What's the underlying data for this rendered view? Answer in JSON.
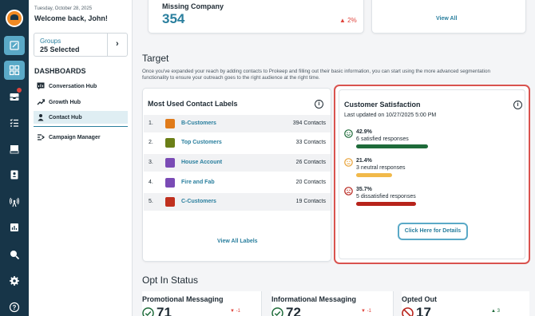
{
  "sidebar": {
    "date": "Tuesday, October 28, 2025",
    "welcome": "Welcome back, John!",
    "groups_label": "Groups",
    "groups_value": "25 Selected",
    "dashboards_heading": "DASHBOARDS",
    "items": [
      {
        "label": "Conversation Hub",
        "icon": "chat-stats-icon"
      },
      {
        "label": "Growth Hub",
        "icon": "growth-chart-icon"
      },
      {
        "label": "Contact Hub",
        "icon": "contact-person-icon",
        "active": true
      },
      {
        "label": "Campaign Manager",
        "icon": "campaign-icon"
      }
    ]
  },
  "rail": {
    "icons": [
      "logo-icon",
      "compose-icon",
      "dashboard-icon",
      "inbox-icon",
      "tasks-icon",
      "folder-icon",
      "contacts-icon",
      "broadcast-icon",
      "reports-icon",
      "search-icon",
      "settings-icon",
      "help-icon"
    ]
  },
  "top_cards": {
    "missing_company": {
      "title": "Missing Company",
      "value": "354",
      "change": "2%"
    },
    "view_all": "View All"
  },
  "target": {
    "title": "Target",
    "description": "Once you've expanded your reach by adding contacts to Prokeep and filling out their basic information, you can start using the more advanced segmentation functionality to ensure your outreach goes to the right audience at the right time."
  },
  "labels_card": {
    "title": "Most Used Contact Labels",
    "rows": [
      {
        "num": "1.",
        "name": "B-Customers",
        "count": "394 Contacts",
        "color": "#e07b1a"
      },
      {
        "num": "2.",
        "name": "Top Customers",
        "count": "33 Contacts",
        "color": "#6b7f17"
      },
      {
        "num": "3.",
        "name": "House Account",
        "count": "26 Contacts",
        "color": "#7a4bb5"
      },
      {
        "num": "4.",
        "name": "Fire and Fab",
        "count": "20 Contacts",
        "color": "#7a4bb5"
      },
      {
        "num": "5.",
        "name": "C-Customers",
        "count": "19 Contacts",
        "color": "#c0301e"
      }
    ],
    "view_all": "View All Labels"
  },
  "satisfaction_card": {
    "title": "Customer Satisfaction",
    "updated": "Last updated on 10/27/2025 5:00 PM",
    "rows": [
      {
        "pct": "42.9%",
        "responses": "6 satisfied responses",
        "share": 0.429,
        "color": "#1e6b3a",
        "icon": "happy-face-icon"
      },
      {
        "pct": "21.4%",
        "responses": "3 neutral responses",
        "share": 0.214,
        "color": "#f1b94a",
        "icon": "neutral-face-icon"
      },
      {
        "pct": "35.7%",
        "responses": "5 dissatisfied responses",
        "share": 0.357,
        "color": "#b7231b",
        "icon": "sad-face-icon"
      }
    ],
    "button": "Click Here for Details"
  },
  "optin": {
    "title": "Opt In Status",
    "cards": [
      {
        "title": "Promotional Messaging",
        "value": "71",
        "change": "-1",
        "dir": "down"
      },
      {
        "title": "Informational Messaging",
        "value": "72",
        "change": "-1",
        "dir": "down"
      },
      {
        "title": "Opted Out",
        "value": "17",
        "change": "3",
        "dir": "up"
      }
    ]
  },
  "colors": {
    "rail": "#173548",
    "accent": "#2a7f9e",
    "highlight_border": "#d9534f"
  }
}
